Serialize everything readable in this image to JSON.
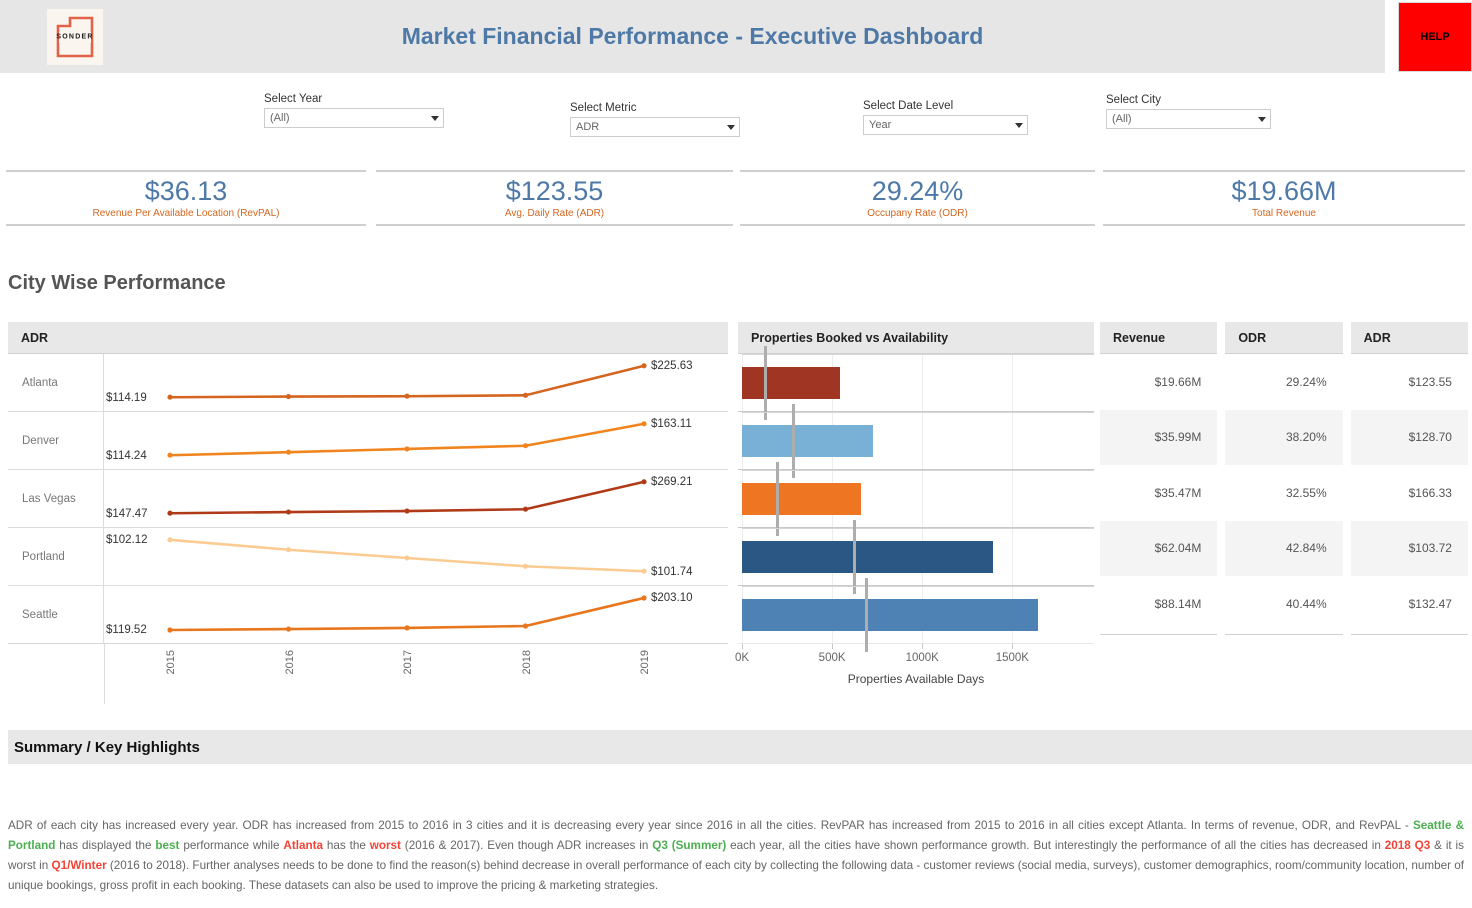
{
  "header": {
    "logo_text": "SONDER",
    "logo_icon": "sonder-logo-icon",
    "title": "Market Financial Performance - Executive Dashboard",
    "help_label": "HELP",
    "bg_color": "#e6e6e6",
    "title_color": "#4e79a7",
    "help_color": "#fe0000"
  },
  "filters": [
    {
      "name": "year",
      "label": "Select Year",
      "value": "(All)"
    },
    {
      "name": "metric",
      "label": "Select Metric",
      "value": "ADR"
    },
    {
      "name": "date",
      "label": "Select Date Level",
      "value": "Year"
    },
    {
      "name": "city",
      "label": "Select City",
      "value": "(All)"
    }
  ],
  "kpis": [
    {
      "value": "$36.13",
      "label": "Revenue Per Available Location (RevPAL)"
    },
    {
      "value": "$123.55",
      "label": "Avg. Daily Rate (ADR)"
    },
    {
      "value": "29.24%",
      "label": "Occupany Rate (ODR)"
    },
    {
      "value": "$19.66M",
      "label": "Total Revenue"
    }
  ],
  "section": {
    "title": "City Wise Performance"
  },
  "line_panel_header": "ADR",
  "bar_panel_header": "Properties Booked vs Availability",
  "table_headers": [
    "Revenue",
    "ODR",
    "ADR"
  ],
  "table_rows": [
    {
      "city": "Atlanta",
      "revenue": "$19.66M",
      "odr": "29.24%",
      "adr": "$123.55"
    },
    {
      "city": "Denver",
      "revenue": "$35.99M",
      "odr": "38.20%",
      "adr": "$128.70"
    },
    {
      "city": "Las Vegas",
      "revenue": "$35.47M",
      "odr": "32.55%",
      "adr": "$166.33"
    },
    {
      "city": "Portland",
      "revenue": "$62.04M",
      "odr": "42.84%",
      "adr": "$103.72"
    },
    {
      "city": "Seattle",
      "revenue": "$88.14M",
      "odr": "40.44%",
      "adr": "$132.47"
    }
  ],
  "summary": {
    "title": "Summary / Key Highlights",
    "text_segments": [
      {
        "t": "ADR of each city has increased every year. ODR has increased from 2015 to 2016 in 3 cities and it is decreasing every year since 2016 in all the cities. RevPAR has increased from 2015 to 2016 in all cities except Atlanta. In terms of revenue, ODR, and RevPAL - "
      },
      {
        "t": "Seattle & Portland",
        "c": "green"
      },
      {
        "t": " has displayed the "
      },
      {
        "t": "best",
        "c": "green"
      },
      {
        "t": " performance while "
      },
      {
        "t": "Atlanta",
        "c": "red"
      },
      {
        "t": " has the "
      },
      {
        "t": "worst",
        "c": "red"
      },
      {
        "t": " (2016 & 2017). Even though ADR increases in "
      },
      {
        "t": "Q3 (Summer)",
        "c": "green"
      },
      {
        "t": " each year, all the cities have shown performance growth. But interestingly the performance of all the cities has decreased in "
      },
      {
        "t": "2018 Q3",
        "c": "red"
      },
      {
        "t": " & it is worst in "
      },
      {
        "t": "Q1/Winter",
        "c": "red"
      },
      {
        "t": " (2016 to 2018). Further analyses needs to be done to find the reason(s) behind decrease in overall performance of each city by collecting the following data - customer reviews (social media, surveys), customer demographics, room/community location, number of unique bookings, gross profit in each booking. These datasets can also be used to improve the pricing & marketing strategies."
      }
    ]
  },
  "chart_data": [
    {
      "type": "line",
      "title": "ADR",
      "xlabel": "",
      "ylabel": "ADR",
      "x": [
        "2015",
        "2016",
        "2017",
        "2018",
        "2019"
      ],
      "xticks": [
        "2015",
        "2016",
        "2017",
        "2018",
        "2019"
      ],
      "grid": true,
      "legend": "none",
      "panel_rows": [
        "Atlanta",
        "Denver",
        "Las Vegas",
        "Portland",
        "Seattle"
      ],
      "series": [
        {
          "name": "Atlanta",
          "values": [
            114.19,
            116.5,
            117.8,
            121.0,
            225.63
          ],
          "start_label": "$114.19",
          "end_label": "$225.63",
          "color": "#d4641e",
          "start_color": "#f7b97a"
        },
        {
          "name": "Denver",
          "values": [
            114.24,
            119.0,
            124.0,
            129.0,
            163.11
          ],
          "start_label": "$114.24",
          "end_label": "$163.11",
          "color": "#f0851f",
          "start_color": "#f6b26b"
        },
        {
          "name": "Las Vegas",
          "values": [
            147.47,
            152.0,
            156.0,
            163.0,
            269.21
          ],
          "start_label": "$147.47",
          "end_label": "$269.21",
          "color": "#b03a18",
          "start_color": "#e2701e"
        },
        {
          "name": "Portland",
          "values": [
            102.12,
            102.0,
            101.9,
            101.8,
            101.74
          ],
          "start_label": "$102.12",
          "end_label": "$101.74",
          "color": "#fbcb92",
          "start_color": "#fbcb92"
        },
        {
          "name": "Seattle",
          "values": [
            119.52,
            122.0,
            125.0,
            130.0,
            203.1
          ],
          "start_label": "$119.52",
          "end_label": "$203.10",
          "color": "#e8761d",
          "start_color": "#f6b26b"
        }
      ]
    },
    {
      "type": "bar",
      "title": "Properties Booked vs Availability",
      "xlabel": "Properties Available Days",
      "ylabel": "",
      "orientation": "horizontal",
      "xlim": [
        0,
        1720000
      ],
      "xticks": [
        0,
        500000,
        1000000,
        1500000
      ],
      "xticklabels": [
        "0K",
        "500K",
        "1000K",
        "1500K"
      ],
      "grid": true,
      "categories": [
        "Atlanta",
        "Denver",
        "Las Vegas",
        "Portland",
        "Seattle"
      ],
      "series": [
        {
          "name": "Properties Available Days",
          "values": [
            545000,
            725000,
            660000,
            1395000,
            1640000
          ]
        },
        {
          "name": "Properties Booked Days (reference)",
          "values": [
            120000,
            275000,
            188000,
            615000,
            685000
          ]
        }
      ],
      "colors": [
        "#a03523",
        "#79b0d6",
        "#ee7623",
        "#2a5784",
        "#4e81b4"
      ],
      "reference_line_color": "#adadad"
    }
  ]
}
